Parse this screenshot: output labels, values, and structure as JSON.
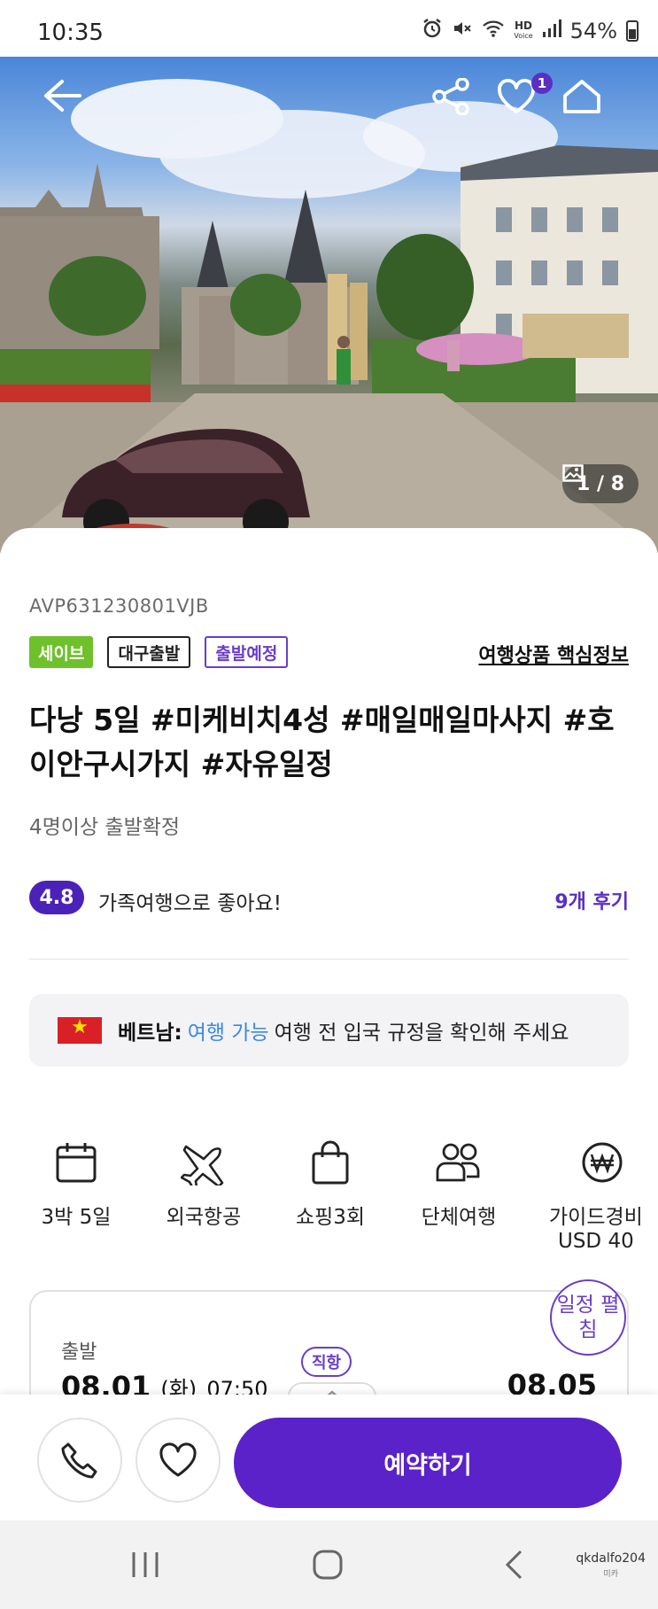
{
  "status_bar": {
    "time": "10:35",
    "battery": "54%",
    "network": "HD",
    "network_sub": "Voice"
  },
  "hero": {
    "image_counter": "1 / 8",
    "wishlist_count": "1",
    "icons": [
      "back-arrow-icon",
      "share-icon",
      "heart-icon",
      "home-icon",
      "image-icon"
    ]
  },
  "product": {
    "code": "AVP631230801VJB",
    "tags": [
      "세이브",
      "대구출발",
      "출발예정"
    ],
    "key_info_link": "여행상품 핵심정보",
    "title": "다낭 5일 #미케비치4성 #매일매일마사지 #호이안구시가지 #자유일정",
    "subtitle": "4명이상 출발확정"
  },
  "rating": {
    "score": "4.8",
    "summary": "가족여행으로 좋아요!",
    "reviews_link": "9개 후기"
  },
  "notice": {
    "country": "베트남:",
    "status": "여행 가능",
    "message": "여행 전 입국 규정을 확인해 주세요"
  },
  "features": [
    {
      "label": "3박 5일",
      "icon": "calendar-icon"
    },
    {
      "label": "외국항공",
      "icon": "airplane-icon"
    },
    {
      "label": "쇼핑3회",
      "icon": "shopping-bag-icon"
    },
    {
      "label": "단체여행",
      "icon": "group-icon"
    },
    {
      "label": "가이드경비",
      "sub": "USD 40",
      "icon": "won-icon"
    }
  ],
  "itinerary": {
    "departure_label": "출발",
    "departure_date": "08.01",
    "departure_day": "(화)",
    "departure_time": "07:50",
    "direct_badge": "직항",
    "return_date": "08.05",
    "expand_label": "일정 펼침"
  },
  "actions": {
    "book_label": "예약하기"
  },
  "watermark": {
    "user": "qkdalfo204",
    "small": "미카"
  },
  "colors": {
    "brand_purple": "#5a22c8",
    "save_green": "#6ec12a",
    "link_blue": "#3b88e0"
  }
}
